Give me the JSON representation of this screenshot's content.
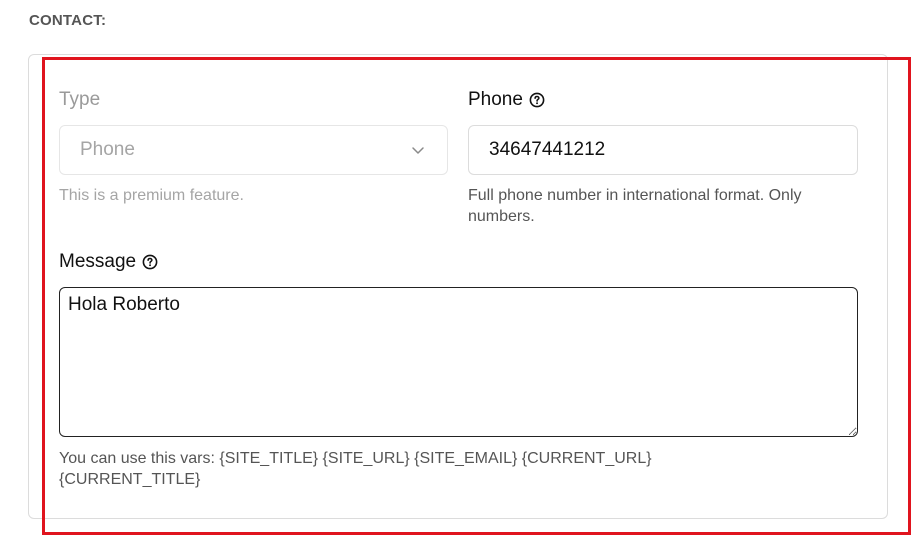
{
  "section": {
    "title": "CONTACT:"
  },
  "type_field": {
    "label": "Type",
    "selected": "Phone",
    "hint": "This is a premium feature."
  },
  "phone_field": {
    "label": "Phone",
    "value": "34647441212",
    "hint": "Full phone number in international format. Only numbers."
  },
  "message_field": {
    "label": "Message",
    "value": "Hola Roberto",
    "hint": "You can use this vars: {SITE_TITLE} {SITE_URL} {SITE_EMAIL} {CURRENT_URL} {CURRENT_TITLE}"
  },
  "icons": {
    "help": "question-circle-icon",
    "select_arrow": "chevron-down-icon"
  },
  "colors": {
    "highlight": "#e0141e",
    "disabled_text": "#a5a5a5",
    "hint_text": "#555555"
  }
}
